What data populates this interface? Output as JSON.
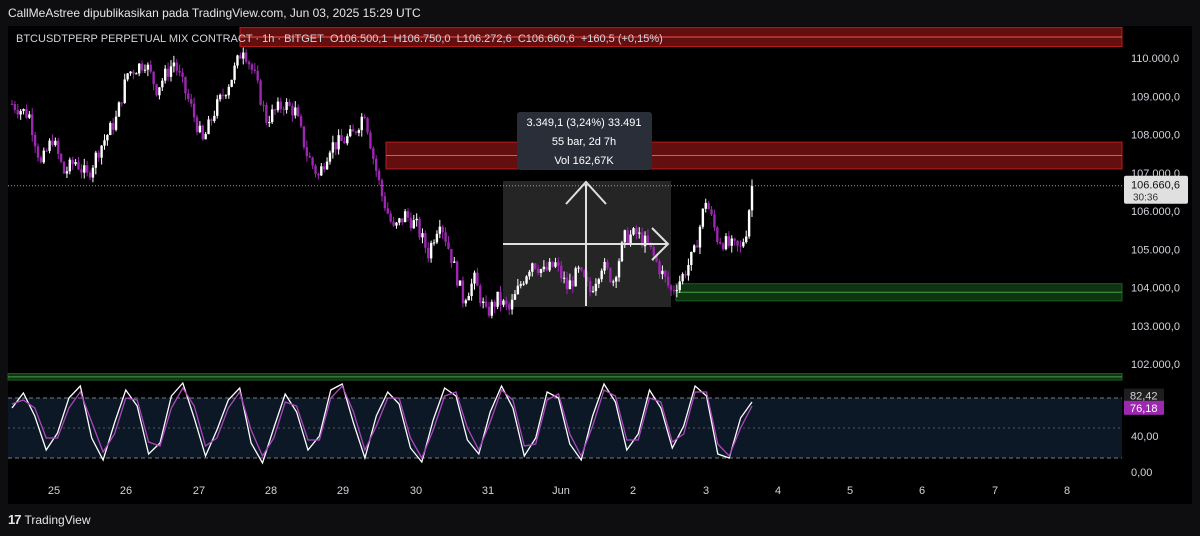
{
  "header": {
    "published": "CallMeAstree dipublikasikan pada TradingView.com, Jun 03, 2025 15:29 UTC"
  },
  "legend": {
    "symbol": "BTCUSDTPERP PERPETUAL MIX CONTRACT · 1h · BITGET",
    "o_label": "O",
    "o": "106.500,1",
    "h_label": "H",
    "h": "106.750,0",
    "l_label": "L",
    "l": "106.272,6",
    "c_label": "C",
    "c": "106.660,6",
    "change": "+160,5 (+0,15%)"
  },
  "measure": {
    "line1": "3.349,1 (3,24%) 33.491",
    "line2": "55 bar, 2d 7h",
    "line3": "Vol 162,67K"
  },
  "price_tag": {
    "price": "106.660,6",
    "countdown": "30:36"
  },
  "osc_tags": {
    "upper": "82,42",
    "current": "76,18"
  },
  "footer": {
    "brand": "TradingView"
  },
  "colors": {
    "bull": "#ffffff",
    "bear": "#9c27b0",
    "resistance": "#b71c1c",
    "support": "#1b5e20",
    "osc_k": "#ffffff",
    "osc_d": "#ab47bc"
  },
  "chart_data": [
    {
      "type": "candlestick",
      "y_axis_ticks": [
        "110.000,0",
        "109.000,0",
        "108.000,0",
        "107.000,0",
        "106.000,0",
        "105.000,0",
        "104.000,0",
        "103.000,0",
        "102.000,0"
      ],
      "x_axis_ticks": [
        "25",
        "26",
        "27",
        "28",
        "29",
        "30",
        "31",
        "Jun",
        "2",
        "3",
        "4",
        "5",
        "6",
        "7",
        "8"
      ],
      "ylim": [
        101500,
        110800
      ],
      "last_price": 106660.6,
      "close_path": [
        {
          "x": 0,
          "y": 108800
        },
        {
          "x": 6,
          "y": 108500
        },
        {
          "x": 10,
          "y": 107200
        },
        {
          "x": 14,
          "y": 107900
        },
        {
          "x": 18,
          "y": 107000
        },
        {
          "x": 22,
          "y": 107300
        },
        {
          "x": 26,
          "y": 106900
        },
        {
          "x": 30,
          "y": 107600
        },
        {
          "x": 36,
          "y": 108400
        },
        {
          "x": 40,
          "y": 109600
        },
        {
          "x": 46,
          "y": 109900
        },
        {
          "x": 50,
          "y": 109200
        },
        {
          "x": 56,
          "y": 109900
        },
        {
          "x": 62,
          "y": 108700
        },
        {
          "x": 66,
          "y": 107800
        },
        {
          "x": 70,
          "y": 108600
        },
        {
          "x": 76,
          "y": 109500
        },
        {
          "x": 80,
          "y": 110300
        },
        {
          "x": 84,
          "y": 109500
        },
        {
          "x": 88,
          "y": 108400
        },
        {
          "x": 94,
          "y": 108800
        },
        {
          "x": 98,
          "y": 108600
        },
        {
          "x": 102,
          "y": 107500
        },
        {
          "x": 106,
          "y": 106900
        },
        {
          "x": 110,
          "y": 107700
        },
        {
          "x": 114,
          "y": 107800
        },
        {
          "x": 118,
          "y": 108000
        },
        {
          "x": 122,
          "y": 108600
        },
        {
          "x": 125,
          "y": 107400
        },
        {
          "x": 128,
          "y": 106400
        },
        {
          "x": 132,
          "y": 105500
        },
        {
          "x": 136,
          "y": 105900
        },
        {
          "x": 140,
          "y": 105600
        },
        {
          "x": 144,
          "y": 104900
        },
        {
          "x": 148,
          "y": 105800
        },
        {
          "x": 152,
          "y": 104800
        },
        {
          "x": 156,
          "y": 103700
        },
        {
          "x": 160,
          "y": 104200
        },
        {
          "x": 164,
          "y": 103300
        },
        {
          "x": 168,
          "y": 103700
        },
        {
          "x": 172,
          "y": 103400
        },
        {
          "x": 176,
          "y": 104100
        },
        {
          "x": 180,
          "y": 104700
        },
        {
          "x": 184,
          "y": 104400
        },
        {
          "x": 188,
          "y": 104600
        },
        {
          "x": 192,
          "y": 104000
        },
        {
          "x": 196,
          "y": 104400
        },
        {
          "x": 200,
          "y": 103900
        },
        {
          "x": 204,
          "y": 104600
        },
        {
          "x": 208,
          "y": 104200
        },
        {
          "x": 212,
          "y": 105300
        },
        {
          "x": 216,
          "y": 105400
        },
        {
          "x": 220,
          "y": 105100
        },
        {
          "x": 224,
          "y": 104500
        },
        {
          "x": 228,
          "y": 103900
        },
        {
          "x": 232,
          "y": 104300
        },
        {
          "x": 236,
          "y": 104900
        },
        {
          "x": 240,
          "y": 106300
        },
        {
          "x": 244,
          "y": 105300
        },
        {
          "x": 248,
          "y": 105100
        },
        {
          "x": 252,
          "y": 105000
        },
        {
          "x": 254,
          "y": 105500
        },
        {
          "x": 256,
          "y": 106660
        }
      ],
      "zones": [
        {
          "kind": "resistance",
          "from": 110800,
          "to": 110300
        },
        {
          "kind": "resistance",
          "from": 107800,
          "to": 107100
        },
        {
          "kind": "support",
          "from": 104100,
          "to": 103650
        },
        {
          "kind": "support",
          "from": 101750,
          "to": 101580
        }
      ]
    },
    {
      "type": "line",
      "y_axis_ticks": [
        "40,00",
        "0,00"
      ],
      "levels": [
        80,
        20
      ],
      "ylim": [
        0,
        100
      ],
      "series": [
        {
          "values": [
            70,
            85,
            62,
            28,
            45,
            80,
            92,
            40,
            18,
            55,
            88,
            72,
            24,
            35,
            82,
            95,
            60,
            22,
            48,
            78,
            90,
            35,
            15,
            50,
            84,
            66,
            28,
            42,
            88,
            94,
            55,
            20,
            62,
            86,
            74,
            30,
            16,
            58,
            90,
            82,
            38,
            24,
            66,
            92,
            70,
            22,
            40,
            86,
            80,
            34,
            18,
            62,
            94,
            76,
            28,
            44,
            88,
            70,
            30,
            52,
            92,
            82,
            24,
            20,
            60,
            76
          ]
        },
        {
          "values": [
            74,
            78,
            70,
            40,
            40,
            70,
            86,
            56,
            26,
            44,
            80,
            78,
            36,
            32,
            70,
            90,
            72,
            32,
            40,
            70,
            86,
            48,
            22,
            40,
            76,
            72,
            38,
            38,
            80,
            92,
            66,
            28,
            52,
            80,
            80,
            40,
            20,
            48,
            82,
            86,
            50,
            28,
            56,
            88,
            78,
            32,
            34,
            78,
            84,
            44,
            22,
            52,
            88,
            82,
            38,
            38,
            80,
            76,
            36,
            44,
            86,
            86,
            34,
            22,
            50,
            72
          ]
        }
      ]
    }
  ]
}
